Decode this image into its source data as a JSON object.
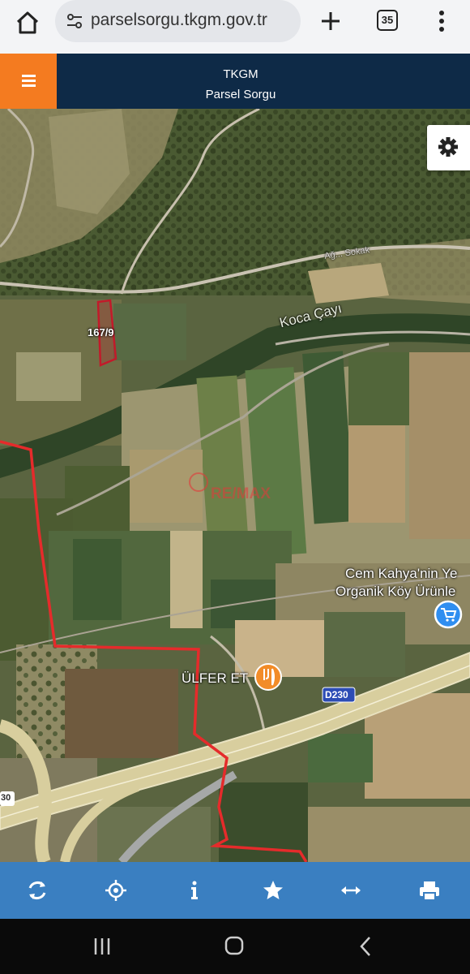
{
  "browser": {
    "url": "parselsorgu.tkgm.gov.tr",
    "tab_count": "35",
    "icons": [
      "home-icon",
      "site-settings-icon",
      "plus-icon",
      "tabs-icon",
      "more-vert-icon"
    ]
  },
  "header": {
    "title": "TKGM",
    "subtitle": "Parsel Sorgu",
    "menu_icon": "hamburger-icon",
    "colors": {
      "header_bg": "#0e2a47",
      "menu_bg": "#f47b20"
    }
  },
  "map": {
    "settings_icon": "gear-icon",
    "labels": {
      "parcel": "167/9",
      "river": "Koca Çayı",
      "road_top": "Ağ... Sokak",
      "place_name_line1": "Cem Kahya'nin Ye",
      "place_name_line2": "Organik Köy Ürünle",
      "restaurant": "ÜLFER ET",
      "highway": "D230",
      "highway_left": "30",
      "watermark": "RE/MAX"
    },
    "colors": {
      "parcel_outline": "#c21a2a",
      "boundary_line": "#e52b2b",
      "restaurant_marker": "#f28c28",
      "shop_marker": "#2f8ef0"
    }
  },
  "toolbar": {
    "buttons": [
      "refresh-icon",
      "locate-icon",
      "info-icon",
      "star-icon",
      "measure-icon",
      "print-icon"
    ],
    "color": "#3a7fc1"
  },
  "system_nav": {
    "buttons": [
      "recents-icon",
      "home-icon",
      "back-icon"
    ]
  }
}
